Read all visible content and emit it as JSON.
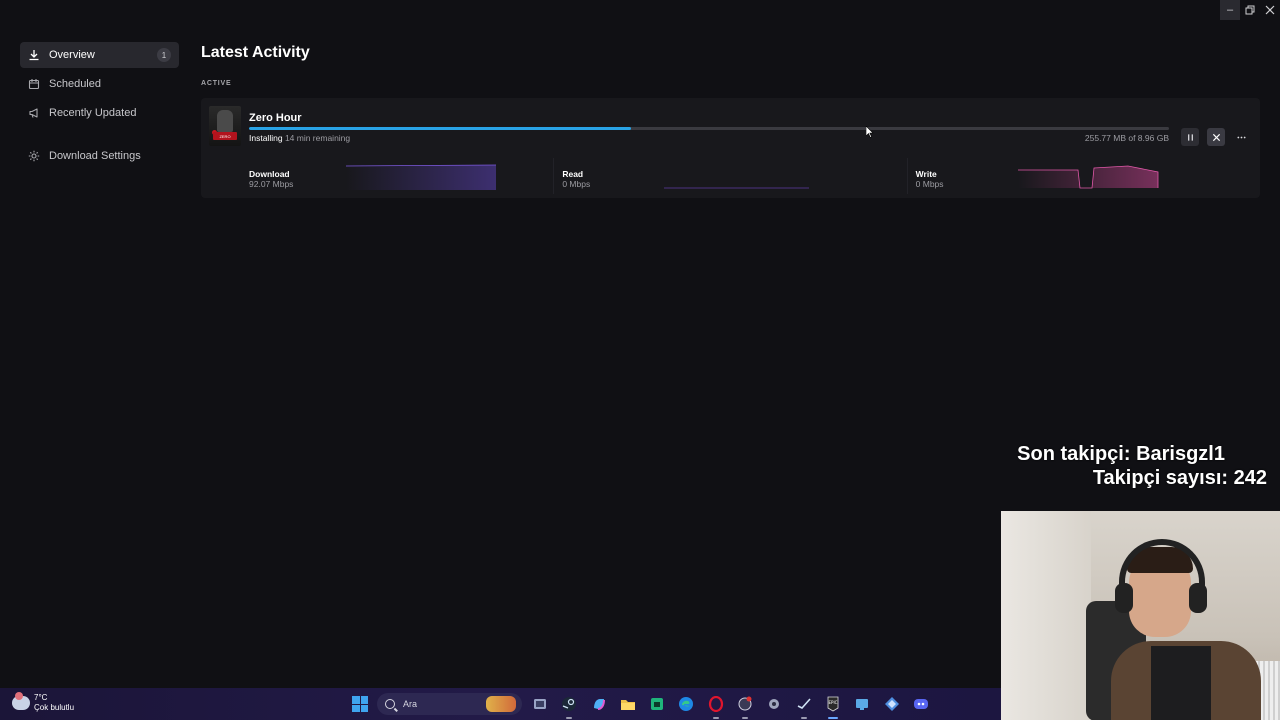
{
  "window_controls": {
    "minimize": "–",
    "restore": "⧉",
    "close": "✕"
  },
  "sidebar": {
    "items": [
      {
        "label": "Overview",
        "icon": "download-icon",
        "badge": "1",
        "active": true
      },
      {
        "label": "Scheduled",
        "icon": "calendar-icon"
      },
      {
        "label": "Recently Updated",
        "icon": "megaphone-icon"
      },
      {
        "label": "Download Settings",
        "icon": "gear-icon"
      }
    ]
  },
  "main": {
    "title": "Latest Activity",
    "section_label": "ACTIVE",
    "download": {
      "game_title": "Zero Hour",
      "thumbnail_text": "ZERO",
      "status": "Installing",
      "time_remaining": "14 min remaining",
      "size_progress": "255.77 MB of 8.96 GB",
      "progress_fraction": 0.415,
      "stats": [
        {
          "label": "Download",
          "value": "92.07 Mbps",
          "color": "#6a4bd6"
        },
        {
          "label": "Read",
          "value": "0 Mbps",
          "color": "#7d4ad8"
        },
        {
          "label": "Write",
          "value": "0 Mbps",
          "color": "#d6489a"
        }
      ]
    },
    "accent_color": "#29a3e6"
  },
  "overlay": {
    "last_follower": "Son takipçi: Barisgzl1",
    "follower_count": "Takipçi sayısı: 242"
  },
  "taskbar": {
    "weather_temp": "7°C",
    "weather_desc": "Çok bulutlu",
    "search_placeholder": "Ara",
    "apps": [
      "task-view-icon",
      "steam-icon",
      "copilot-icon",
      "file-explorer-icon",
      "store-icon",
      "edge-icon",
      "opera-icon",
      "app-icon",
      "settings-icon",
      "steam-icon",
      "epic-games-icon",
      "remote-desktop-icon",
      "network-icon",
      "discord-icon"
    ]
  }
}
